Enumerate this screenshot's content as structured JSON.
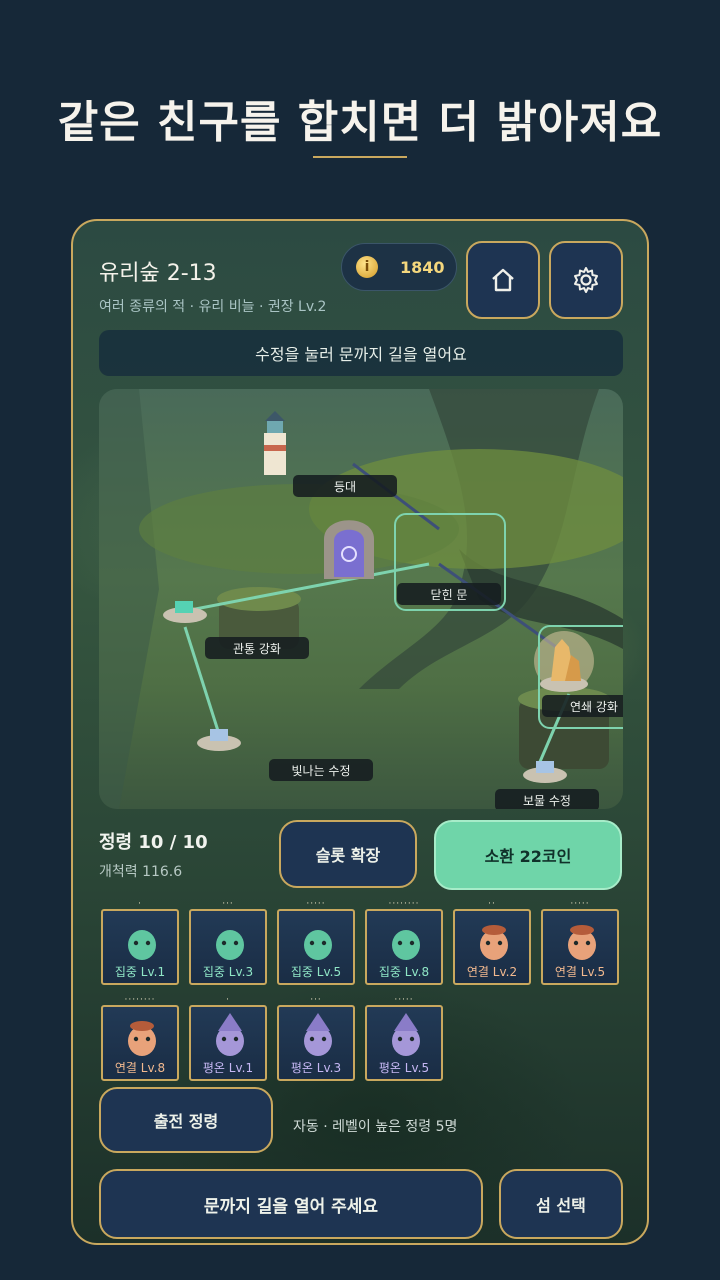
{
  "headline": "같은 친구를 합치면 더 밝아져요",
  "header": {
    "stage_title": "유리숲 2-13",
    "stage_subtitle": "여러 종류의 적 · 유리 비늘 · 권장 Lv.2",
    "coins": "1840",
    "coin_icon": "coin-icon",
    "home_icon": "home-icon",
    "settings_icon": "gear-icon"
  },
  "hint": "수정을 눌러 문까지 길을 열어요",
  "map": {
    "nodes": [
      {
        "id": "lighthouse",
        "label": "등대",
        "icon": "lighthouse-icon"
      },
      {
        "id": "gate",
        "label": "닫힌 문",
        "icon": "gate-icon"
      },
      {
        "id": "pierce",
        "label": "관통 강화",
        "icon": "crystal-pedestal-icon"
      },
      {
        "id": "chain",
        "label": "연쇄 강화",
        "icon": "crystal-cluster-icon"
      },
      {
        "id": "shining",
        "label": "빛나는 수정",
        "icon": "crystal-pedestal-icon"
      },
      {
        "id": "treasure",
        "label": "보물 수정",
        "icon": "crystal-pedestal-icon"
      }
    ],
    "path_color": "#7ed3ae"
  },
  "army": {
    "title": "정령 10 / 10",
    "power": "개척력 116.6",
    "slot_button": "슬롯 확장",
    "summon_button": "소환  22코인"
  },
  "units": [
    {
      "label": "집중 Lv.1",
      "dots": "·",
      "type": "focus",
      "color": "#5fc6a0",
      "label_color": "#8fe6c6"
    },
    {
      "label": "집중 Lv.3",
      "dots": "···",
      "type": "focus",
      "color": "#5fc6a0",
      "label_color": "#8fe6c6"
    },
    {
      "label": "집중 Lv.5",
      "dots": "·····",
      "type": "focus",
      "color": "#5fc6a0",
      "label_color": "#8fe6c6"
    },
    {
      "label": "집중 Lv.8",
      "dots": "········",
      "type": "focus",
      "color": "#5fc6a0",
      "label_color": "#8fe6c6"
    },
    {
      "label": "연결 Lv.2",
      "dots": "··",
      "type": "link",
      "color": "#e8a27a",
      "label_color": "#f2b98f"
    },
    {
      "label": "연결 Lv.5",
      "dots": "·····",
      "type": "link",
      "color": "#e8a27a",
      "label_color": "#f2b98f"
    },
    {
      "label": "연결 Lv.8",
      "dots": "········",
      "type": "link",
      "color": "#e8a27a",
      "label_color": "#f2b98f"
    },
    {
      "label": "평온 Lv.1",
      "dots": "·",
      "type": "calm",
      "color": "#a597d8",
      "label_color": "#c5b7f3"
    },
    {
      "label": "평온 Lv.3",
      "dots": "···",
      "type": "calm",
      "color": "#a597d8",
      "label_color": "#c5b7f3"
    },
    {
      "label": "평온 Lv.5",
      "dots": "·····",
      "type": "calm",
      "color": "#a597d8",
      "label_color": "#c5b7f3"
    }
  ],
  "sortie": {
    "button": "출전 정령",
    "note": "자동 · 레벨이 높은 정령 5명"
  },
  "footer": {
    "main_cta": "문까지 길을 열어 주세요",
    "island_select": "섬 선택"
  }
}
